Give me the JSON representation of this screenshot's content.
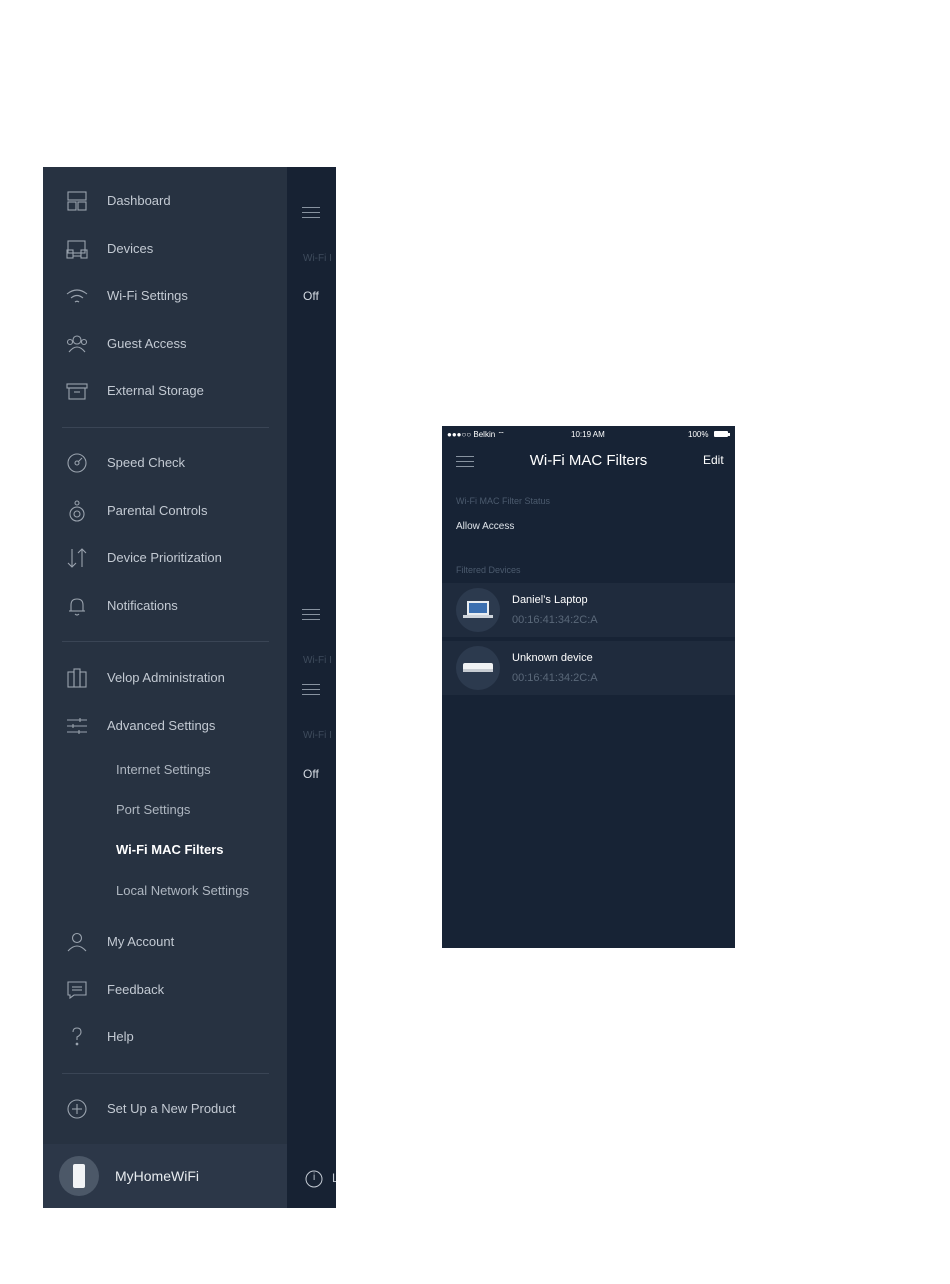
{
  "menu": {
    "items": [
      {
        "label": "Dashboard",
        "icon": "dashboard-icon"
      },
      {
        "label": "Devices",
        "icon": "devices-icon"
      },
      {
        "label": "Wi-Fi Settings",
        "icon": "wifi-icon"
      },
      {
        "label": "Guest Access",
        "icon": "guest-access-icon"
      },
      {
        "label": "External Storage",
        "icon": "storage-icon"
      },
      {
        "label": "Speed Check",
        "icon": "speed-check-icon"
      },
      {
        "label": "Parental Controls",
        "icon": "parental-controls-icon"
      },
      {
        "label": "Device Prioritization",
        "icon": "prioritization-icon"
      },
      {
        "label": "Notifications",
        "icon": "bell-icon"
      },
      {
        "label": "Velop Administration",
        "icon": "velop-admin-icon"
      },
      {
        "label": "Advanced Settings",
        "icon": "sliders-icon"
      },
      {
        "label": "My Account",
        "icon": "account-icon"
      },
      {
        "label": "Feedback",
        "icon": "feedback-icon"
      },
      {
        "label": "Help",
        "icon": "help-icon"
      },
      {
        "label": "Set Up a New Product",
        "icon": "plus-circle-icon"
      }
    ],
    "advanced_subitems": [
      {
        "label": "Internet Settings",
        "active": false
      },
      {
        "label": "Port Settings",
        "active": false
      },
      {
        "label": "Wi-Fi MAC Filters",
        "active": true
      },
      {
        "label": "Local Network Settings",
        "active": false
      }
    ],
    "footer": {
      "network_name": "MyHomeWiFi",
      "icon": "velop-node-icon"
    }
  },
  "behind_screen": {
    "section_label_1": "Wi-Fi I",
    "value_1": "Off",
    "section_label_2": "Wi-Fi I",
    "section_label_3": "Wi-Fi I",
    "value_2": "Off",
    "info_char": "i",
    "footer_cut": "L"
  },
  "phone2": {
    "status_bar": {
      "carrier": "●●●○○ Belkin ⌔",
      "time": "10:19 AM",
      "battery": "100%"
    },
    "title": "Wi-Fi MAC Filters",
    "edit_label": "Edit",
    "status_section": {
      "label": "Wi-Fi MAC Filter Status",
      "value": "Allow Access"
    },
    "devices_section_label": "Filtered Devices",
    "devices": [
      {
        "name": "Daniel’s Laptop",
        "mac": "00:16:41:34:2C:A",
        "icon": "laptop-icon"
      },
      {
        "name": "Unknown device",
        "mac": "00:16:41:34:2C:A",
        "icon": "generic-device-icon"
      }
    ]
  },
  "colors": {
    "menu_background": "#273241",
    "screen_background": "#172335",
    "active_text": "#ffffff",
    "muted_text": "#4b5a6d"
  }
}
